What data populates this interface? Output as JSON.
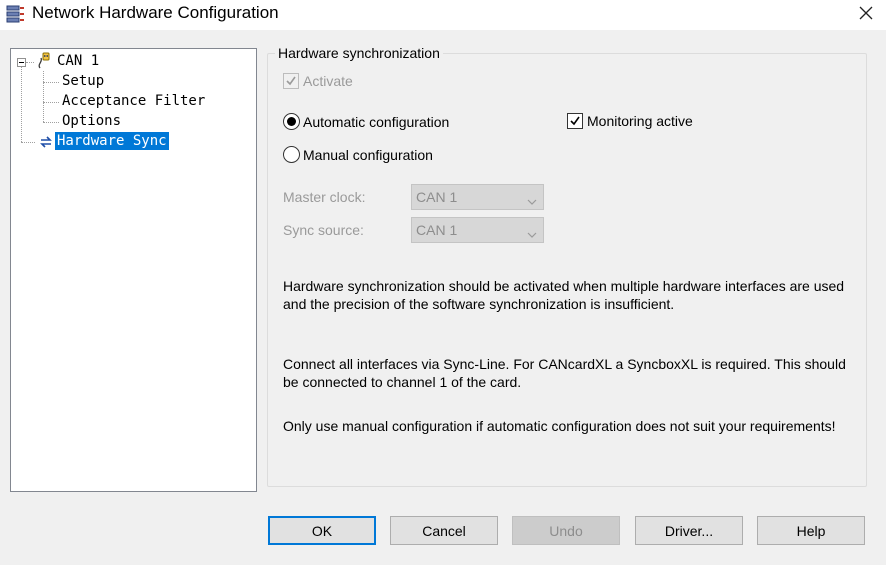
{
  "window": {
    "title": "Network Hardware Configuration",
    "icons": {
      "app": "network-config-icon",
      "close": "close-icon"
    }
  },
  "tree": {
    "root": {
      "label": "CAN 1",
      "icon": "network-plug-icon",
      "expanded": true
    },
    "children": [
      {
        "label": "Setup"
      },
      {
        "label": "Acceptance Filter"
      },
      {
        "label": "Options"
      }
    ],
    "sync": {
      "label": "Hardware Sync",
      "icon": "sync-icon",
      "selected": true
    }
  },
  "group": {
    "legend": "Hardware synchronization",
    "activate": {
      "label": "Activate",
      "checked": true,
      "enabled": false
    },
    "auto_config": {
      "label": "Automatic configuration",
      "selected": true
    },
    "manual_config": {
      "label": "Manual configuration",
      "selected": false
    },
    "monitoring": {
      "label": "Monitoring active",
      "checked": true
    },
    "master_clock": {
      "label": "Master clock:",
      "value": "CAN 1"
    },
    "sync_source": {
      "label": "Sync source:",
      "value": "CAN 1"
    },
    "paragraphs": [
      "Hardware synchronization should be activated when multiple hardware interfaces are used and the precision of the software synchronization is insufficient.",
      "Connect all interfaces via Sync-Line. For CANcardXL a SyncboxXL is required. This should be connected to channel 1 of the card.",
      "Only use manual configuration if automatic configuration does not suit your requirements!"
    ]
  },
  "buttons": {
    "ok": "OK",
    "cancel": "Cancel",
    "undo": "Undo",
    "driver": "Driver...",
    "help": "Help"
  },
  "colors": {
    "selection": "#0078d7",
    "default_button_border": "#0078d7",
    "window_bg": "#f0f0f0",
    "disabled_text": "#9a9a9a"
  }
}
